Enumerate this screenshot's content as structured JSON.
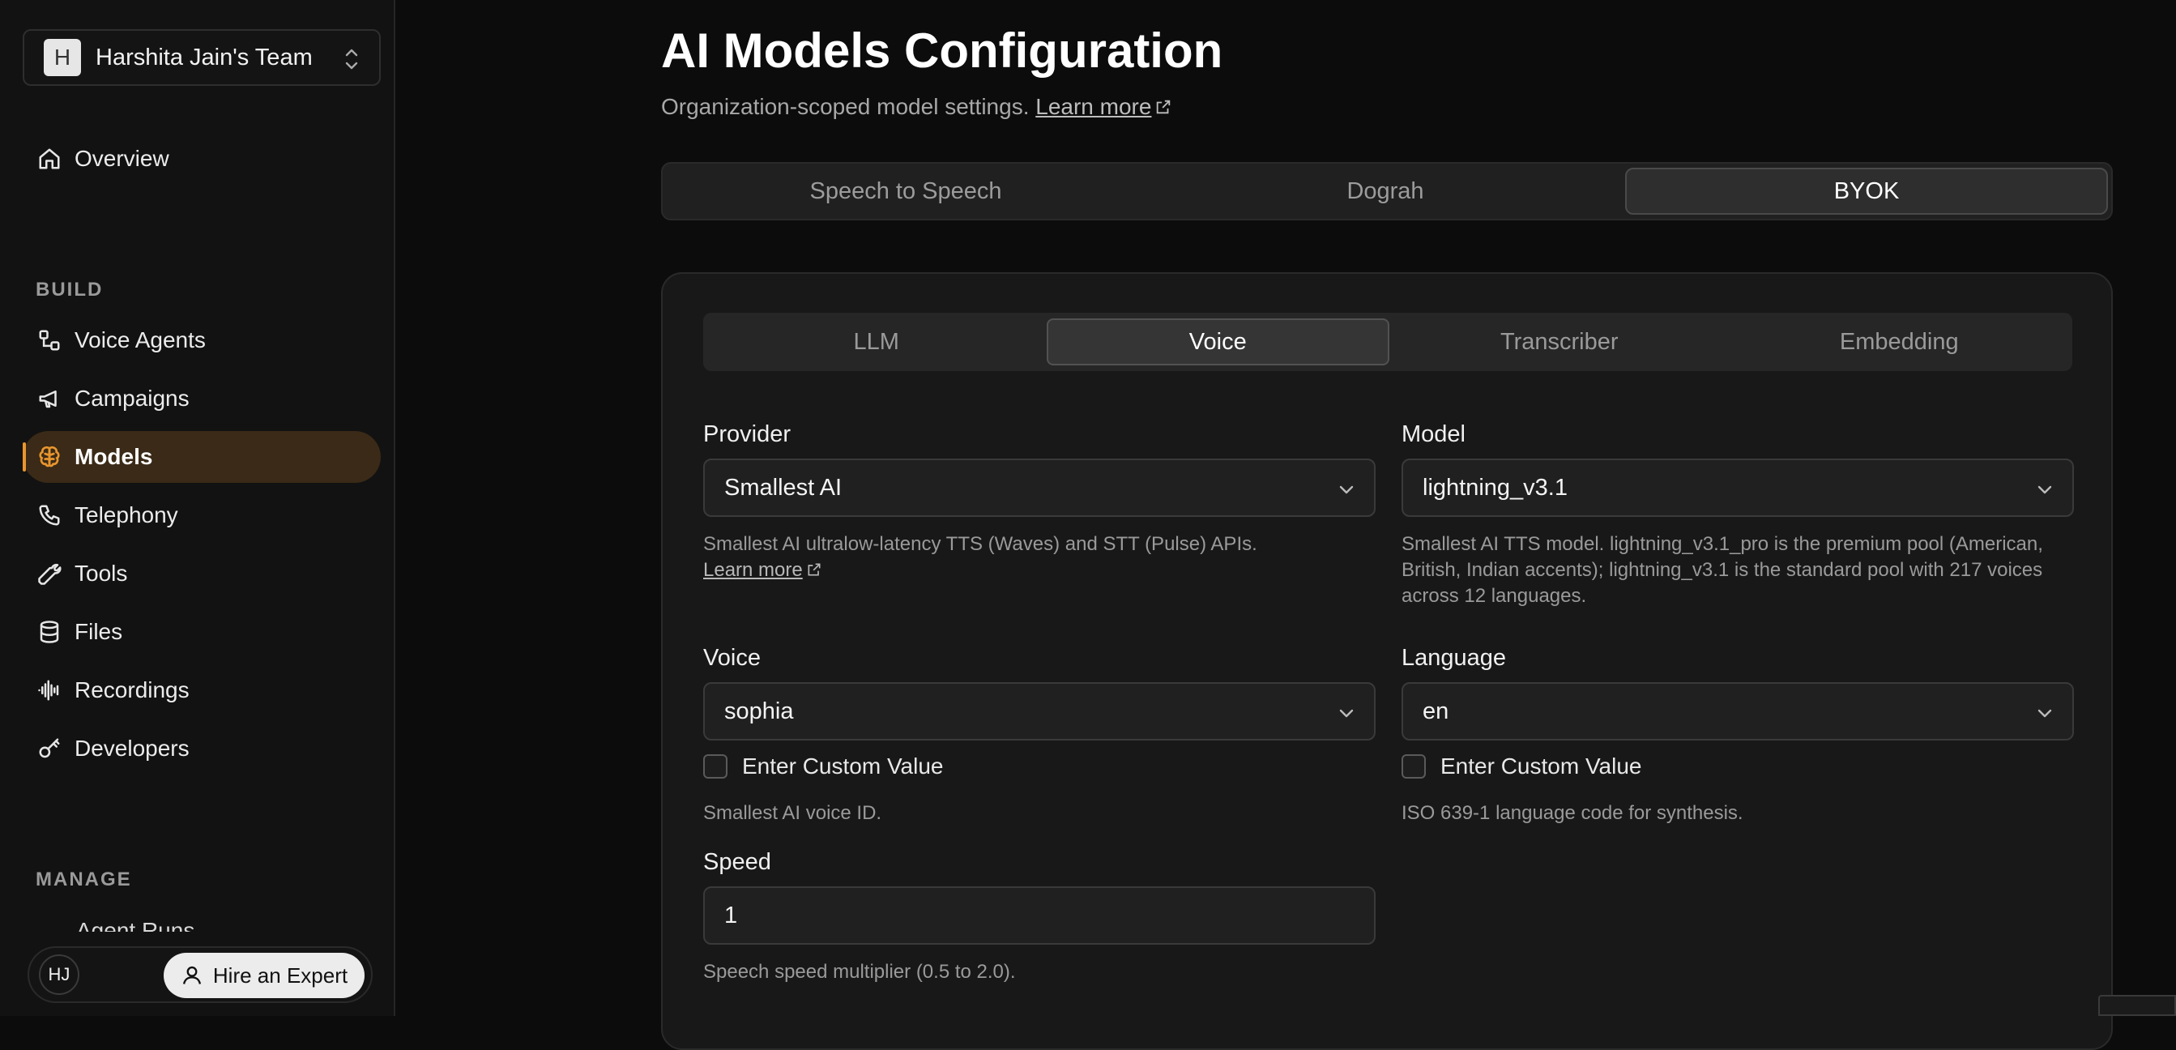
{
  "sidebar": {
    "team": {
      "avatar_letter": "H",
      "name": "Harshita Jain's Team"
    },
    "overview_label": "Overview",
    "build_section": "BUILD",
    "build_items": [
      {
        "label": "Voice Agents",
        "icon": "voice-agents-icon"
      },
      {
        "label": "Campaigns",
        "icon": "megaphone-icon"
      },
      {
        "label": "Models",
        "icon": "brain-icon",
        "active": true
      },
      {
        "label": "Telephony",
        "icon": "phone-icon"
      },
      {
        "label": "Tools",
        "icon": "wrench-icon"
      },
      {
        "label": "Files",
        "icon": "database-icon"
      },
      {
        "label": "Recordings",
        "icon": "audio-waveform-icon"
      },
      {
        "label": "Developers",
        "icon": "key-icon"
      }
    ],
    "manage_section": "MANAGE",
    "manage_clipped_item": "Agent Runs",
    "footer": {
      "user_initials": "HJ",
      "hire_label": "Hire an Expert"
    },
    "accent_color": "#e8962e"
  },
  "header": {
    "title": "AI Models Configuration",
    "subtitle": "Organization-scoped model settings.",
    "learn_more": "Learn more"
  },
  "top_tabs": [
    "Speech to Speech",
    "Dograh",
    "BYOK"
  ],
  "top_tab_active": "BYOK",
  "sub_tabs": [
    "LLM",
    "Voice",
    "Transcriber",
    "Embedding"
  ],
  "sub_tab_active": "Voice",
  "form": {
    "provider": {
      "label": "Provider",
      "value": "Smallest AI",
      "help": "Smallest AI ultralow-latency TTS (Waves) and STT (Pulse) APIs.",
      "learn_more": "Learn more"
    },
    "model": {
      "label": "Model",
      "value": "lightning_v3.1",
      "help": "Smallest AI TTS model. lightning_v3.1_pro is the premium pool (American, British, Indian accents); lightning_v3.1 is the standard pool with 217 voices across 12 languages."
    },
    "voice": {
      "label": "Voice",
      "value": "sophia",
      "custom_label": "Enter Custom Value",
      "help": "Smallest AI voice ID."
    },
    "language": {
      "label": "Language",
      "value": "en",
      "custom_label": "Enter Custom Value",
      "help": "ISO 639-1 language code for synthesis."
    },
    "speed": {
      "label": "Speed",
      "value": "1",
      "help": "Speech speed multiplier (0.5 to 2.0)."
    }
  }
}
